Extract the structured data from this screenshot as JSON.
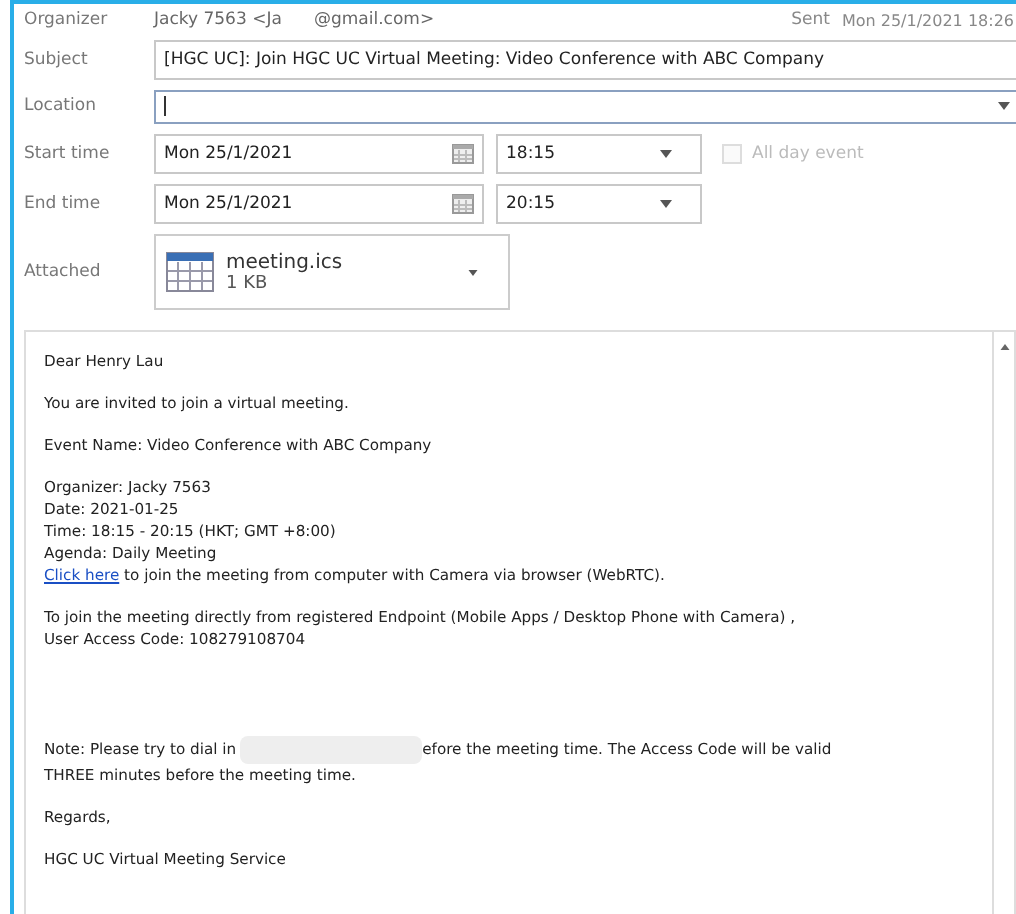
{
  "header": {
    "organizer_label": "Organizer",
    "organizer_name": "Jacky 7563 <Ja",
    "organizer_domain": "@gmail.com>",
    "sent_label": "Sent",
    "sent_value": "Mon 25/1/2021 18:26"
  },
  "fields": [
    {
      "kind": "text",
      "label": "Subject",
      "value": "[HGC UC]: Join HGC UC Virtual Meeting: Video Conference with ABC Company"
    },
    {
      "kind": "location",
      "label": "Location"
    }
  ],
  "times": [
    {
      "label": "Start time",
      "date": "Mon 25/1/2021",
      "time": "18:15",
      "all_day": {
        "label": "All day event",
        "checked": false,
        "disabled": true
      }
    },
    {
      "label": "End time",
      "date": "Mon 25/1/2021",
      "time": "20:15"
    }
  ],
  "attachment": {
    "label": "Attached",
    "name": "meeting.ics",
    "size": "1 KB"
  },
  "body": [
    {
      "lines": [
        {
          "kind": "text",
          "text": "Dear Henry Lau"
        }
      ]
    },
    {
      "lines": [
        {
          "kind": "text",
          "text": "You are invited to join a virtual meeting."
        }
      ]
    },
    {
      "lines": [
        {
          "kind": "text",
          "text": "Event Name: Video Conference with ABC Company"
        }
      ]
    },
    {
      "lines": [
        {
          "kind": "text",
          "text": "Organizer: Jacky 7563"
        },
        {
          "kind": "text",
          "text": "Date: 2021-01-25"
        },
        {
          "kind": "text",
          "text": "Time: 18:15 - 20:15 (HKT; GMT +8:00)"
        },
        {
          "kind": "text",
          "text": "Agenda: Daily Meeting"
        },
        {
          "kind": "link",
          "link": "Click here",
          "text": "to join the meeting from computer with Camera via browser (WebRTC)."
        }
      ]
    },
    {
      "lines": [
        {
          "kind": "text",
          "text": "To join the meeting directly from registered Endpoint (Mobile Apps / Desktop Phone with Camera) ,"
        },
        {
          "kind": "text",
          "text": "User Access Code: 108279108704"
        }
      ],
      "space_after": true
    },
    {
      "lines": [
        {
          "kind": "redacted",
          "text": "Note: Please try to dial in",
          "after": "efore the meeting time. The Access Code will be valid"
        },
        {
          "kind": "text",
          "text": "THREE minutes before the meeting time."
        }
      ]
    },
    {
      "lines": [
        {
          "kind": "text",
          "text": "Regards,"
        }
      ]
    },
    {
      "lines": [
        {
          "kind": "text",
          "text": "HGC UC Virtual Meeting Service"
        }
      ]
    }
  ]
}
